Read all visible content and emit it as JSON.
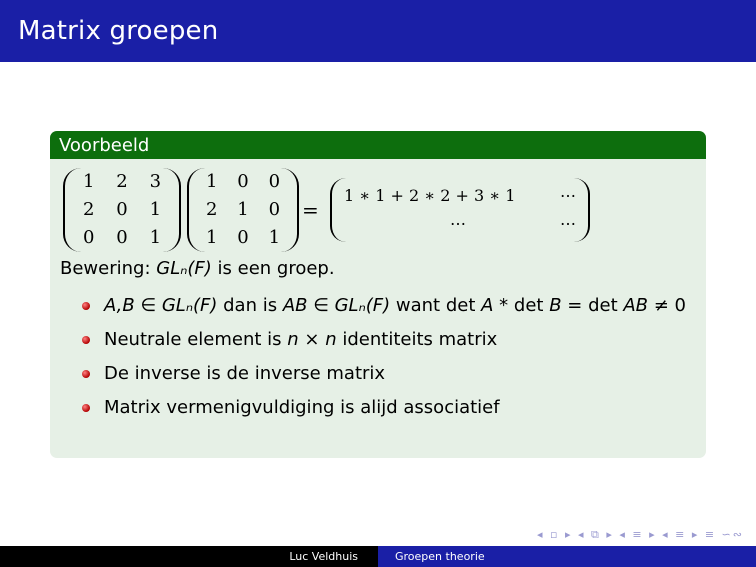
{
  "slide": {
    "title": "Matrix groepen"
  },
  "example": {
    "header": "Voorbeeld",
    "matrix_a": [
      "1",
      "2",
      "3",
      "2",
      "0",
      "1",
      "0",
      "0",
      "1"
    ],
    "matrix_b": [
      "1",
      "0",
      "0",
      "2",
      "1",
      "0",
      "1",
      "0",
      "1"
    ],
    "equals": "=",
    "result_row1": "1 ∗ 1 + 2 ∗ 2 + 3 ∗ 1",
    "result_row1_end": "…",
    "result_row2_mid": "…",
    "result_row2_end": "…",
    "claim_prefix": "Bewering: ",
    "claim_math": "GLₙ(F)",
    "claim_suffix": " is een groep.",
    "bullets": [
      {
        "parts": [
          "A,B ∈ GLₙ(F)",
          " dan is ",
          "AB ∈ GLₙ(F)",
          " want det ",
          "A",
          " * det ",
          "B",
          " = det ",
          "AB",
          " ≠ 0"
        ]
      },
      {
        "parts": [
          "Neutrale element is ",
          "n × n",
          " identiteits matrix"
        ]
      },
      {
        "text": "De inverse is de inverse matrix"
      },
      {
        "text": "Matrix vermenigvuldiging is alijd associatief"
      }
    ]
  },
  "nav": {
    "symbols": "◂ ▫ ▸ ◂ ⧉ ▸ ◂ ≡ ▸ ◂ ≡ ▸ ≡ ∽∾"
  },
  "footer": {
    "author": "Luc Veldhuis",
    "topic": "Groepen theorie"
  }
}
